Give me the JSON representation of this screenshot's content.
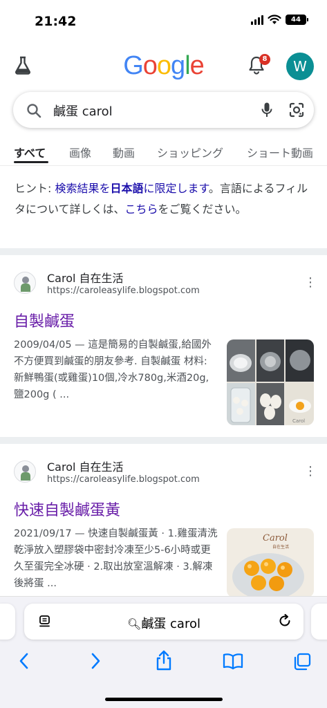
{
  "status_bar": {
    "time": "21:42",
    "battery": "44"
  },
  "header": {
    "logo_letters": [
      "G",
      "o",
      "o",
      "g",
      "l",
      "e"
    ],
    "logo_colors": [
      "#4285F4",
      "#EA4335",
      "#FBBC05",
      "#4285F4",
      "#34A853",
      "#EA4335"
    ],
    "notification_count": "8",
    "avatar_letter": "W"
  },
  "search": {
    "query": "鹹蛋 carol"
  },
  "tabs": [
    "すべて",
    "画像",
    "動画",
    "ショッピング",
    "ショート動画"
  ],
  "hint": {
    "prefix": "ヒント: ",
    "link_part1": "検索結果を",
    "link_bold": "日本語",
    "link_part2": "に限定します",
    "middle": "。言語によるフィルタについて詳しくは、",
    "link2": "こちら",
    "suffix": "をご覧ください。"
  },
  "results": [
    {
      "site_name": "Carol 自在生活",
      "url": "https://caroleasylife.blogspot.com",
      "title": "自製鹹蛋",
      "snippet": "2009/04/05 — 這是簡易的自製鹹蛋,給國外不方便買到鹹蛋的朋友參考. 自製鹹蛋 材料: 新鮮鴨蛋(或雞蛋)10個,冷水780g,米酒20g,鹽200g ( ...",
      "thumb_watermark": "Carol"
    },
    {
      "site_name": "Carol 自在生活",
      "url": "https://caroleasylife.blogspot.com",
      "title": "快速自製鹹蛋黃",
      "snippet": "2021/09/17 — 快速自製鹹蛋黃 · 1.雞蛋清洗乾淨放入塑膠袋中密封冷凍至少5-6小時或更 久至蛋完全冰硬 · 2.取出放室溫解凍 · 3.解凍後將蛋 ...",
      "thumb_watermark": "Carol",
      "thumb_caption": "自在生活"
    }
  ],
  "safari": {
    "address": "鹹蛋 carol"
  },
  "colors": {
    "link": "#1a0dab",
    "visited": "#681da8",
    "ios_blue": "#007aff",
    "avatar": "#0b8f94"
  }
}
